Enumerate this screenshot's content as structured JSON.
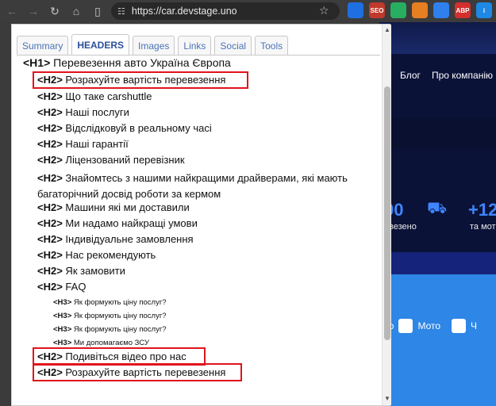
{
  "browser": {
    "url": "https://car.devstage.uno",
    "icons": [
      "back-arrow-icon",
      "forward-arrow-icon",
      "reload-icon",
      "home-icon",
      "sidebar-icon",
      "site-settings-icon",
      "bookmark-star-icon"
    ]
  },
  "extensions": [
    {
      "name": "ext-blue",
      "color": "#1f6fe0",
      "label": ""
    },
    {
      "name": "ext-seo",
      "color": "#c0392b",
      "label": "SEO"
    },
    {
      "name": "ext-green",
      "color": "#27ae60",
      "label": ""
    },
    {
      "name": "ext-orange",
      "color": "#e67e22",
      "label": ""
    },
    {
      "name": "ext-doc",
      "color": "#2f80ed",
      "label": ""
    },
    {
      "name": "ext-abp",
      "color": "#d32f2f",
      "label": "ABP"
    },
    {
      "name": "ext-info",
      "color": "#1e88e5",
      "label": "i"
    }
  ],
  "site": {
    "nav": [
      "Блог",
      "Про компанію"
    ],
    "stat_1_value": "00",
    "stat_1_label": "везено",
    "stat_2_value": "+12",
    "stat_2_label": "та мот",
    "option_1": "ато",
    "option_2": "Мото",
    "option_3": "Ч"
  },
  "panel": {
    "tabs": [
      "Summary",
      "HEADERS",
      "Images",
      "Links",
      "Social",
      "Tools"
    ],
    "active_tab": "HEADERS",
    "headers": [
      {
        "level": "H1",
        "tag": "<H1>",
        "text": "Перевезення авто Україна Європа"
      },
      {
        "level": "H2",
        "tag": "<H2>",
        "text": "Розрахуйте вартість перевезення",
        "highlight": true
      },
      {
        "level": "H2",
        "tag": "<H2>",
        "text": "Що таке carshuttle"
      },
      {
        "level": "H2",
        "tag": "<H2>",
        "text": "Наші послуги"
      },
      {
        "level": "H2",
        "tag": "<H2>",
        "text": "Відслідковуй в реальному часі"
      },
      {
        "level": "H2",
        "tag": "<H2>",
        "text": "Наші гарантії"
      },
      {
        "level": "H2",
        "tag": "<H2>",
        "text": "Ліцензований перевізник"
      },
      {
        "level": "H2",
        "tag": "<H2>",
        "text": "Знайомтесь з нашими найкращими драйверами, які мають багаторічний досвід роботи за кермом",
        "wrap": true
      },
      {
        "level": "H2",
        "tag": "<H2>",
        "text": "Машини які ми доставили"
      },
      {
        "level": "H2",
        "tag": "<H2>",
        "text": "Ми надамо найкращі умови"
      },
      {
        "level": "H2",
        "tag": "<H2>",
        "text": "Індивідуальне замовлення"
      },
      {
        "level": "H2",
        "tag": "<H2>",
        "text": "Нас рекомендують"
      },
      {
        "level": "H2",
        "tag": "<H2>",
        "text": "Як замовити"
      },
      {
        "level": "H2",
        "tag": "<H2>",
        "text": "FAQ"
      },
      {
        "level": "H3",
        "tag": "<H3>",
        "text": "Як формують ціну послуг?"
      },
      {
        "level": "H3",
        "tag": "<H3>",
        "text": "Як формують ціну послуг?"
      },
      {
        "level": "H3",
        "tag": "<H3>",
        "text": "Як формують ціну послуг?"
      },
      {
        "level": "H3",
        "tag": "<H3>",
        "text": "Ми допомагаємо ЗСУ"
      },
      {
        "level": "H2",
        "tag": "<H2>",
        "text": "Подивіться відео про нас",
        "highlight": true
      },
      {
        "level": "H2",
        "tag": "<H2>",
        "text": "Розрахуйте вартість перевезення",
        "highlight": true
      }
    ]
  }
}
